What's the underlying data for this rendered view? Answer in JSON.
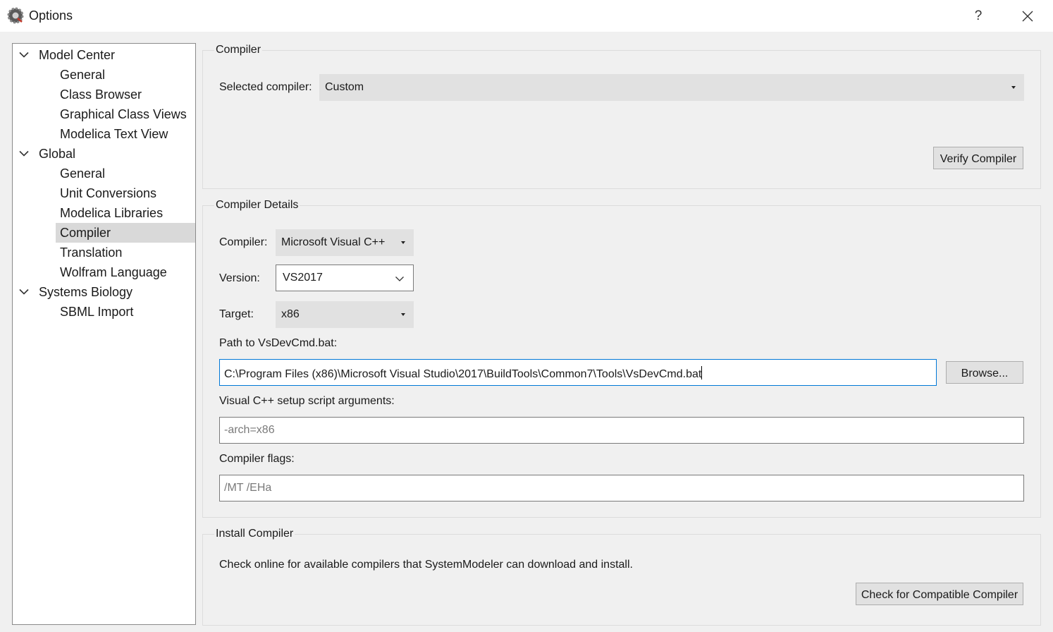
{
  "window": {
    "title": "Options",
    "help_label": "?",
    "icon": "gear-icon",
    "close_icon": "close-icon"
  },
  "tree": {
    "items": [
      {
        "label": "Model Center",
        "level": 0,
        "expanded": true
      },
      {
        "label": "General",
        "level": 1
      },
      {
        "label": "Class Browser",
        "level": 1
      },
      {
        "label": "Graphical Class Views",
        "level": 1
      },
      {
        "label": "Modelica Text View",
        "level": 1
      },
      {
        "label": "Global",
        "level": 0,
        "expanded": true
      },
      {
        "label": "General",
        "level": 1
      },
      {
        "label": "Unit Conversions",
        "level": 1
      },
      {
        "label": "Modelica Libraries",
        "level": 1
      },
      {
        "label": "Compiler",
        "level": 1,
        "selected": true
      },
      {
        "label": "Translation",
        "level": 1
      },
      {
        "label": "Wolfram Language",
        "level": 1
      },
      {
        "label": "Systems Biology",
        "level": 0,
        "expanded": true
      },
      {
        "label": "SBML Import",
        "level": 1
      }
    ]
  },
  "compiler": {
    "group_title": "Compiler",
    "selected_label": "Selected compiler:",
    "selected_value": "Custom",
    "verify_button": "Verify Compiler"
  },
  "details": {
    "group_title": "Compiler Details",
    "compiler_label": "Compiler:",
    "compiler_value": "Microsoft Visual C++",
    "version_label": "Version:",
    "version_value": "VS2017",
    "target_label": "Target:",
    "target_value": "x86",
    "path_label": "Path to VsDevCmd.bat:",
    "path_value": "C:\\Program Files (x86)\\Microsoft Visual Studio\\2017\\BuildTools\\Common7\\Tools\\VsDevCmd.bat",
    "browse_button": "Browse...",
    "args_label": "Visual C++ setup script arguments:",
    "args_placeholder": "-arch=x86",
    "flags_label": "Compiler flags:",
    "flags_placeholder": "/MT /EHa"
  },
  "install": {
    "group_title": "Install Compiler",
    "description": "Check online for available compilers that SystemModeler can download and install.",
    "check_button": "Check for Compatible Compiler"
  }
}
